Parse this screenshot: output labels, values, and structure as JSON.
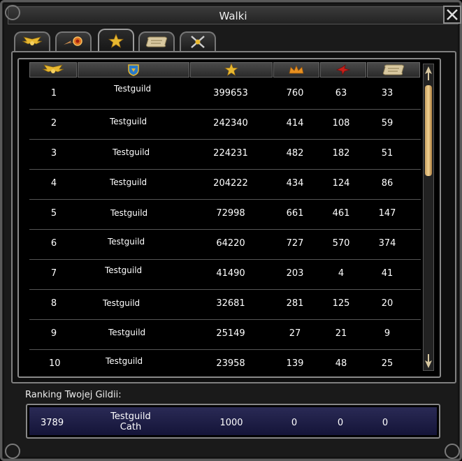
{
  "window": {
    "title": "Walki"
  },
  "tabs": [
    {
      "icon": "winged-emblem-icon",
      "active": false
    },
    {
      "icon": "winged-orb-icon",
      "active": false
    },
    {
      "icon": "star-icon",
      "active": true
    },
    {
      "icon": "scroll-icon",
      "active": false
    },
    {
      "icon": "crossed-swords-icon",
      "active": false
    }
  ],
  "columns": [
    {
      "icon": "winged-emblem-icon"
    },
    {
      "icon": "guild-crest-icon"
    },
    {
      "icon": "star-icon"
    },
    {
      "icon": "crown-icon"
    },
    {
      "icon": "red-bird-icon"
    },
    {
      "icon": "scroll-icon"
    }
  ],
  "rows": [
    {
      "rank": "1",
      "guild": "Testguild",
      "points": "399653",
      "a": "760",
      "b": "63",
      "c": "33"
    },
    {
      "rank": "2",
      "guild": "Testguild",
      "points": "242340",
      "a": "414",
      "b": "108",
      "c": "59"
    },
    {
      "rank": "3",
      "guild": "Testguild",
      "points": "224231",
      "a": "482",
      "b": "182",
      "c": "51"
    },
    {
      "rank": "4",
      "guild": "Testguild",
      "points": "204222",
      "a": "434",
      "b": "124",
      "c": "86"
    },
    {
      "rank": "5",
      "guild": "Testguild",
      "points": "72998",
      "a": "661",
      "b": "461",
      "c": "147"
    },
    {
      "rank": "6",
      "guild": "Testguild",
      "points": "64220",
      "a": "727",
      "b": "570",
      "c": "374"
    },
    {
      "rank": "7",
      "guild": "Testguild",
      "points": "41490",
      "a": "203",
      "b": "4",
      "c": "41"
    },
    {
      "rank": "8",
      "guild": "Testguild",
      "points": "32681",
      "a": "281",
      "b": "125",
      "c": "20"
    },
    {
      "rank": "9",
      "guild": "Testguild",
      "points": "25149",
      "a": "27",
      "b": "21",
      "c": "9"
    },
    {
      "rank": "10",
      "guild": "Testguild",
      "points": "23958",
      "a": "139",
      "b": "48",
      "c": "25"
    }
  ],
  "own_ranking": {
    "label": "Ranking Twojej Gildii:",
    "rank": "3789",
    "guild": "Testguild",
    "guild_line2": "Cath",
    "points": "1000",
    "a": "0",
    "b": "0",
    "c": "0"
  },
  "colors": {
    "gold": "#e8b830",
    "own_row": "#22224a",
    "frame": "#8a8a8a"
  }
}
